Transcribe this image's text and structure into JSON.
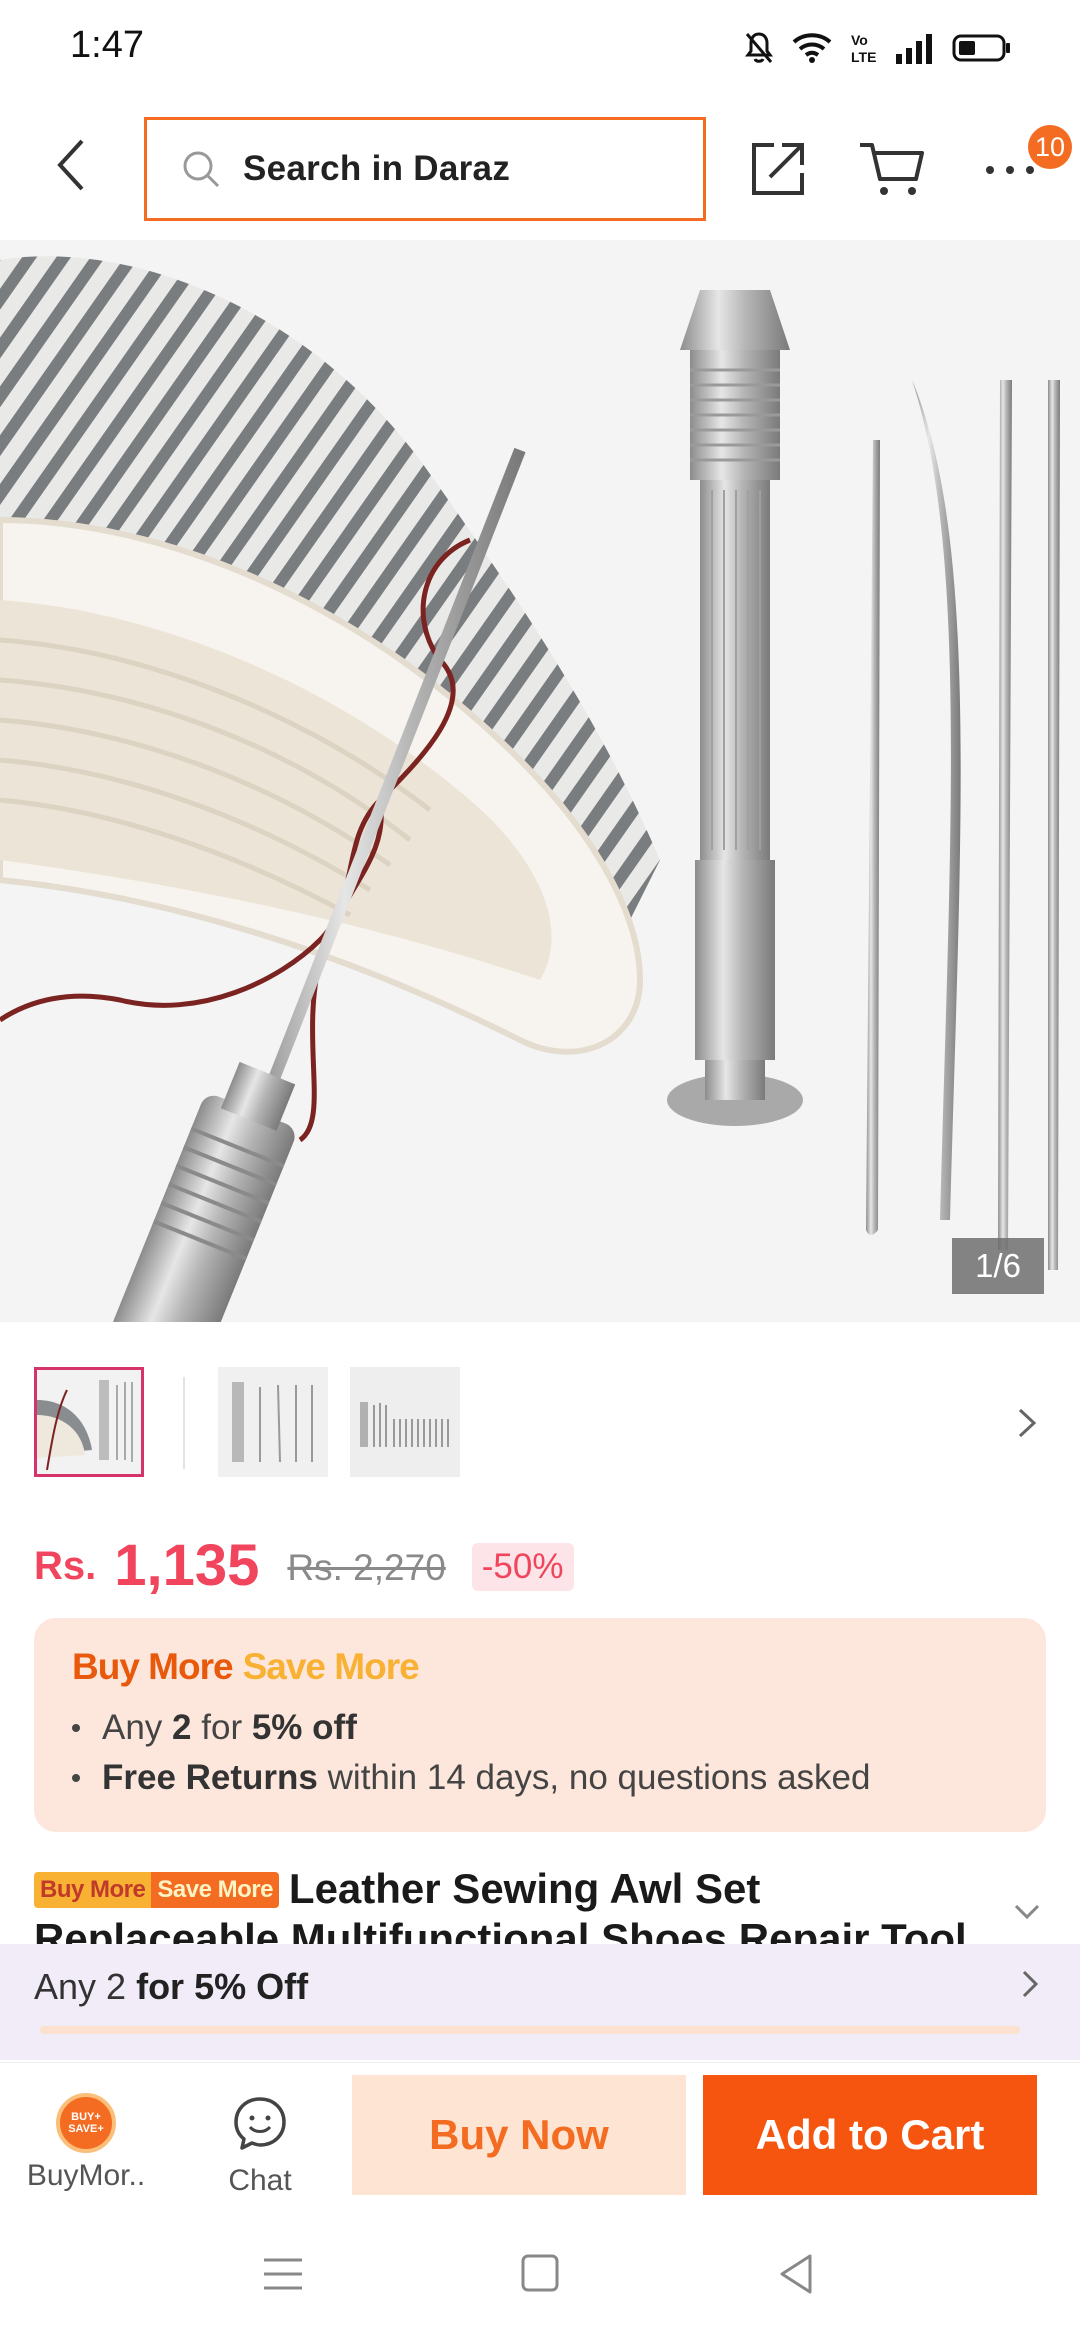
{
  "status_bar": {
    "time": "1:47",
    "icons": [
      "mute-bell-icon",
      "wifi-icon",
      "volte-icon",
      "signal-icon",
      "battery-icon"
    ]
  },
  "top_nav": {
    "search_placeholder": "Search in Daraz",
    "cart_badge": "10",
    "accent_color": "#f36c21"
  },
  "gallery": {
    "counter": "1/6",
    "thumbnail_count": 3
  },
  "price": {
    "currency": "Rs.",
    "current": "1,135",
    "original": "Rs. 2,270",
    "discount": "-50%"
  },
  "promo": {
    "title_part1": "Buy More",
    "title_part2": "Save More",
    "line1_prefix": "Any",
    "line1_qty": "2",
    "line1_mid": "for",
    "line1_off": "5% off",
    "line2_bold": "Free Returns",
    "line2_rest": "within 14 days, no questions asked"
  },
  "product": {
    "tag_part1": "Buy More",
    "tag_part2": "Save More",
    "title": "Leather Sewing Awl Set Replaceable Multifunctional Shoes Repair Tool Kit Punch S"
  },
  "offer_bar": {
    "prefix": "Any 2",
    "bold": "for 5% Off"
  },
  "action_bar": {
    "buymore_label": "BuyMor..",
    "buymore_icon_text": "BUY+ SAVE+",
    "chat_label": "Chat",
    "buy_now": "Buy Now",
    "add_to_cart": "Add to Cart"
  }
}
